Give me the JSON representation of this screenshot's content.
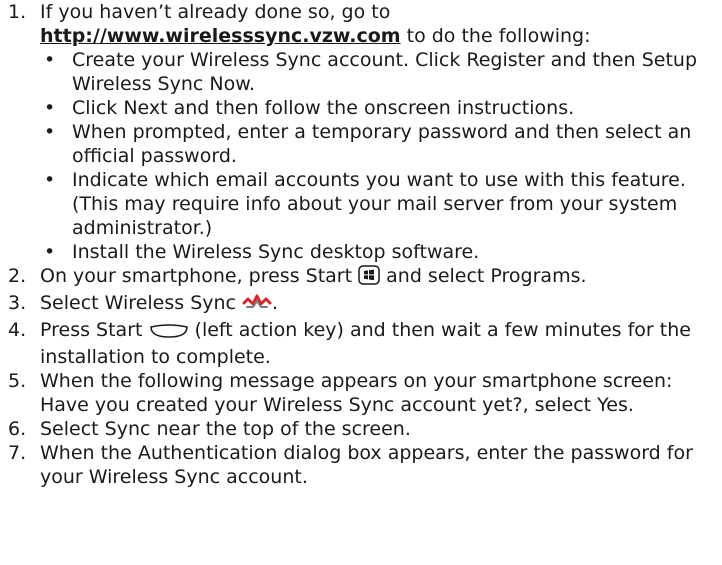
{
  "steps": [
    {
      "num": "1.",
      "pre": "If you haven’t already done so, go to",
      "link": "http://www.wirelesssync.vzw.com",
      "post": " to do the following:"
    },
    {
      "num": "2.",
      "pre": "On your smartphone, press Start ",
      "post": " and select Programs."
    },
    {
      "num": "3.",
      "pre": "Select Wireless Sync ",
      "post": "."
    },
    {
      "num": "4.",
      "pre": "Press Start ",
      "post": " (left action key) and then wait a few minutes for the installation to complete."
    },
    {
      "num": "5.",
      "text": "When the following message appears on your smartphone screen: Have you created your Wireless Sync account yet?, select Yes."
    },
    {
      "num": "6.",
      "text": "Select Sync near the top of the screen."
    },
    {
      "num": "7.",
      "text": "When the Authentication dialog box appears, enter the password for your Wireless Sync account."
    }
  ],
  "bullets": [
    "Create your Wireless Sync account. Click Register and then Setup Wireless Sync Now.",
    "Click Next and then follow the onscreen instructions.",
    "When prompted, enter a temporary password and then select an official password.",
    "Indicate which email accounts you want to use with this feature. (This may require info about your mail server from your system administrator.)",
    "Install the Wireless Sync desktop software."
  ],
  "bullet_char": "•",
  "icons": {
    "start": "windows-start-key-icon",
    "sync": "wireless-sync-icon",
    "softkey": "left-action-key-icon"
  },
  "colors": {
    "text": "#1a1a1a",
    "sync_red": "#d2282d"
  }
}
